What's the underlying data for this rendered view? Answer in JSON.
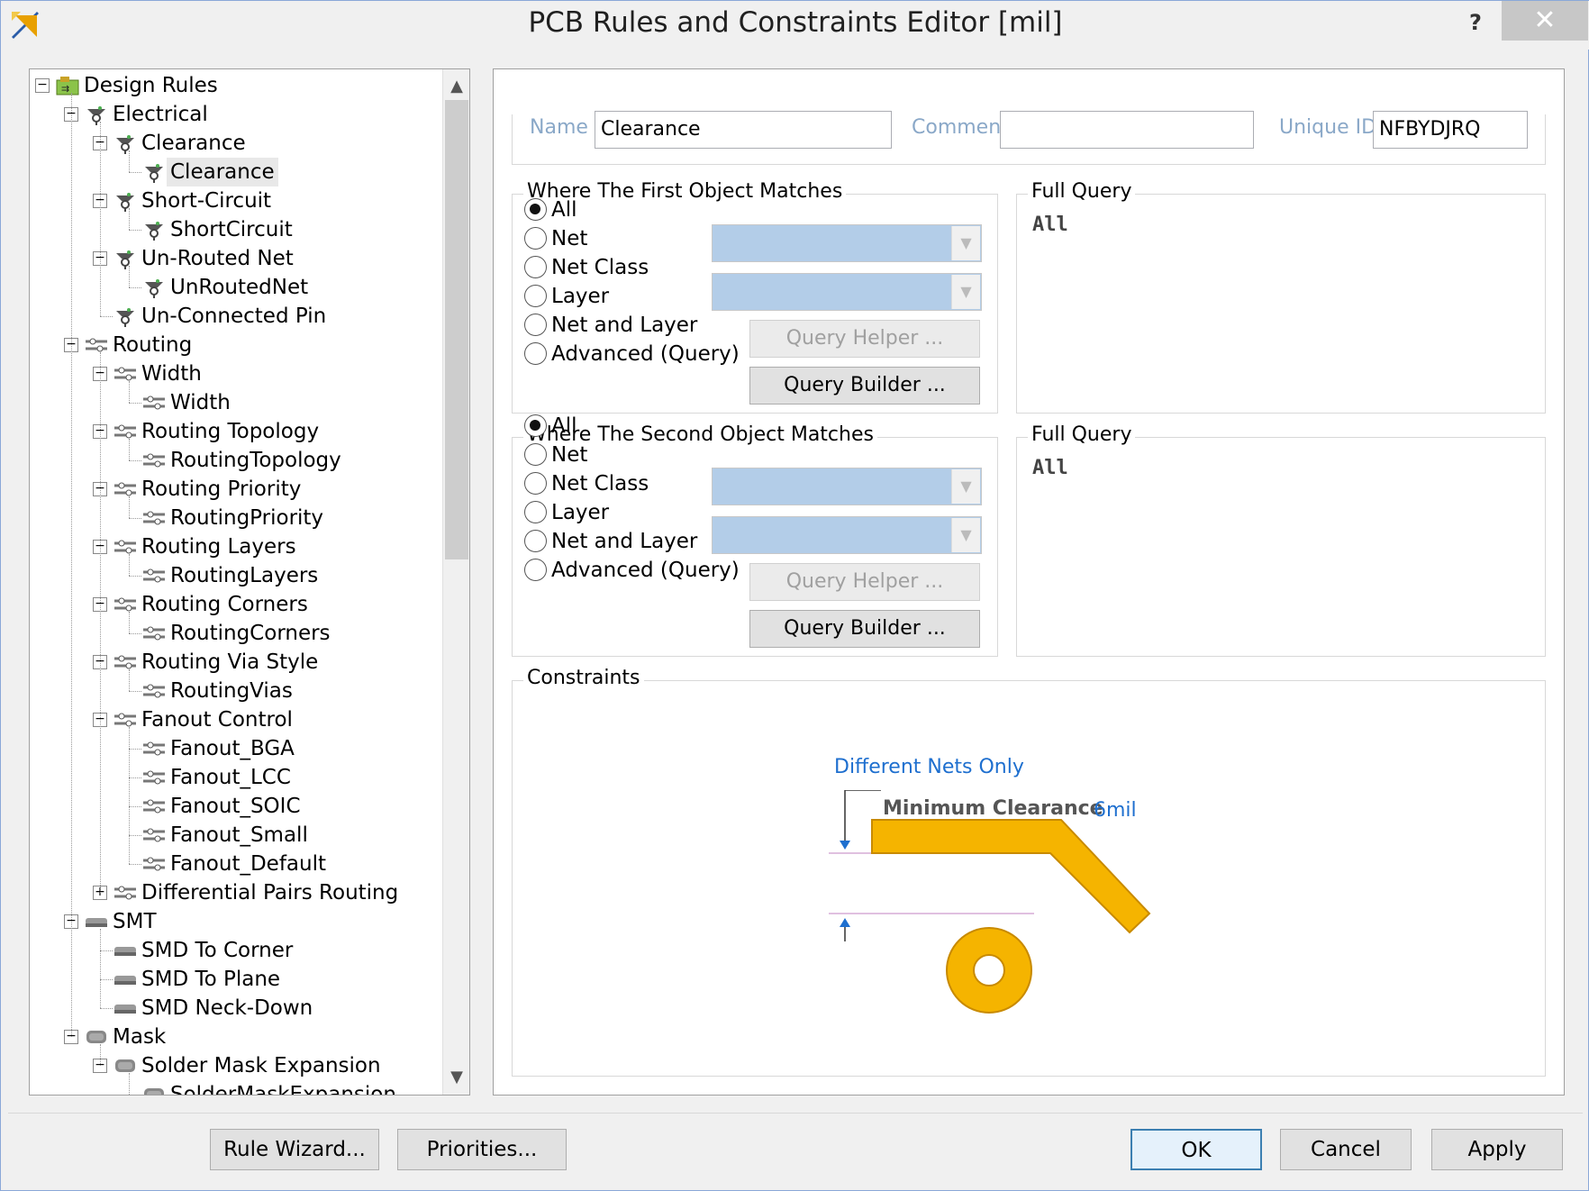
{
  "window": {
    "title": "PCB Rules and Constraints Editor [mil]",
    "help_label": "?",
    "close_label": "✕"
  },
  "tree": [
    {
      "label": "Design Rules",
      "level": 0,
      "expander": "−",
      "icon": "design-rules-icon"
    },
    {
      "label": "Electrical",
      "level": 1,
      "expander": "−",
      "icon": "electrical-rule-icon"
    },
    {
      "label": "Clearance",
      "level": 2,
      "expander": "−",
      "icon": "electrical-rule-icon"
    },
    {
      "label": "Clearance",
      "level": 3,
      "expander": "",
      "icon": "electrical-rule-icon",
      "selected": true
    },
    {
      "label": "Short-Circuit",
      "level": 2,
      "expander": "−",
      "icon": "electrical-rule-icon"
    },
    {
      "label": "ShortCircuit",
      "level": 3,
      "expander": "",
      "icon": "electrical-rule-icon"
    },
    {
      "label": "Un-Routed Net",
      "level": 2,
      "expander": "−",
      "icon": "electrical-rule-icon"
    },
    {
      "label": "UnRoutedNet",
      "level": 3,
      "expander": "",
      "icon": "electrical-rule-icon"
    },
    {
      "label": "Un-Connected Pin",
      "level": 2,
      "expander": "",
      "icon": "electrical-rule-icon"
    },
    {
      "label": "Routing",
      "level": 1,
      "expander": "−",
      "icon": "routing-rule-icon"
    },
    {
      "label": "Width",
      "level": 2,
      "expander": "−",
      "icon": "routing-rule-icon"
    },
    {
      "label": "Width",
      "level": 3,
      "expander": "",
      "icon": "routing-rule-icon"
    },
    {
      "label": "Routing Topology",
      "level": 2,
      "expander": "−",
      "icon": "routing-rule-icon"
    },
    {
      "label": "RoutingTopology",
      "level": 3,
      "expander": "",
      "icon": "routing-rule-icon"
    },
    {
      "label": "Routing Priority",
      "level": 2,
      "expander": "−",
      "icon": "routing-rule-icon"
    },
    {
      "label": "RoutingPriority",
      "level": 3,
      "expander": "",
      "icon": "routing-rule-icon"
    },
    {
      "label": "Routing Layers",
      "level": 2,
      "expander": "−",
      "icon": "routing-rule-icon"
    },
    {
      "label": "RoutingLayers",
      "level": 3,
      "expander": "",
      "icon": "routing-rule-icon"
    },
    {
      "label": "Routing Corners",
      "level": 2,
      "expander": "−",
      "icon": "routing-rule-icon"
    },
    {
      "label": "RoutingCorners",
      "level": 3,
      "expander": "",
      "icon": "routing-rule-icon"
    },
    {
      "label": "Routing Via Style",
      "level": 2,
      "expander": "−",
      "icon": "routing-rule-icon"
    },
    {
      "label": "RoutingVias",
      "level": 3,
      "expander": "",
      "icon": "routing-rule-icon"
    },
    {
      "label": "Fanout Control",
      "level": 2,
      "expander": "−",
      "icon": "routing-rule-icon"
    },
    {
      "label": "Fanout_BGA",
      "level": 3,
      "expander": "",
      "icon": "routing-rule-icon"
    },
    {
      "label": "Fanout_LCC",
      "level": 3,
      "expander": "",
      "icon": "routing-rule-icon"
    },
    {
      "label": "Fanout_SOIC",
      "level": 3,
      "expander": "",
      "icon": "routing-rule-icon"
    },
    {
      "label": "Fanout_Small",
      "level": 3,
      "expander": "",
      "icon": "routing-rule-icon"
    },
    {
      "label": "Fanout_Default",
      "level": 3,
      "expander": "",
      "icon": "routing-rule-icon"
    },
    {
      "label": "Differential Pairs Routing",
      "level": 2,
      "expander": "+",
      "icon": "routing-rule-icon"
    },
    {
      "label": "SMT",
      "level": 1,
      "expander": "−",
      "icon": "smt-rule-icon"
    },
    {
      "label": "SMD To Corner",
      "level": 2,
      "expander": "",
      "icon": "smt-rule-icon"
    },
    {
      "label": "SMD To Plane",
      "level": 2,
      "expander": "",
      "icon": "smt-rule-icon"
    },
    {
      "label": "SMD Neck-Down",
      "level": 2,
      "expander": "",
      "icon": "smt-rule-icon"
    },
    {
      "label": "Mask",
      "level": 1,
      "expander": "−",
      "icon": "mask-rule-icon"
    },
    {
      "label": "Solder Mask Expansion",
      "level": 2,
      "expander": "−",
      "icon": "mask-rule-icon"
    },
    {
      "label": "SolderMaskExpansion",
      "level": 3,
      "expander": "",
      "icon": "mask-rule-icon"
    }
  ],
  "scroll": {
    "up": "▲",
    "down": "▼"
  },
  "rule": {
    "name_label": "Name",
    "name_value": "Clearance",
    "comment_label": "Comment",
    "comment_value": "",
    "uid_label": "Unique ID",
    "uid_value": "NFBYDJRQ"
  },
  "first_match": {
    "title": "Where The First Object Matches",
    "options": [
      "All",
      "Net",
      "Net Class",
      "Layer",
      "Net and Layer",
      "Advanced (Query)"
    ],
    "selected": "All",
    "query_helper": "Query Helper ...",
    "query_builder": "Query Builder ...",
    "full_query_title": "Full Query",
    "full_query": "All"
  },
  "second_match": {
    "title": "Where The Second Object Matches",
    "options": [
      "All",
      "Net",
      "Net Class",
      "Layer",
      "Net and Layer",
      "Advanced (Query)"
    ],
    "selected": "All",
    "query_helper": "Query Helper ...",
    "query_builder": "Query Builder ...",
    "full_query_title": "Full Query",
    "full_query": "All"
  },
  "constraints": {
    "title": "Constraints",
    "net_scope": "Different Nets Only",
    "min_clearance_label": "Minimum Clearance",
    "min_clearance_value": "6mil"
  },
  "buttons": {
    "rule_wizard": "Rule Wizard...",
    "priorities": "Priorities...",
    "ok": "OK",
    "cancel": "Cancel",
    "apply": "Apply"
  },
  "colors": {
    "accent": "#1e6fcf",
    "trace": "#f5b400",
    "combo_fill": "#b3cde8"
  }
}
